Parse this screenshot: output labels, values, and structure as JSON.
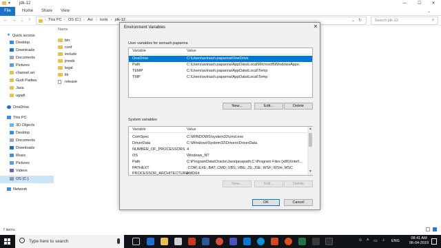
{
  "explorer": {
    "title": "jdk-12",
    "ribbon_tabs": [
      "File",
      "Home",
      "Share",
      "View"
    ],
    "breadcrumb": [
      "This PC",
      "OS (C:)",
      "Avi",
      "tools",
      "jdk-12"
    ],
    "search_placeholder": "Search jdk-12",
    "nav_items": [
      {
        "label": "Quick access"
      },
      {
        "label": "Desktop"
      },
      {
        "label": "Downloads"
      },
      {
        "label": "Documents"
      },
      {
        "label": "Pictures"
      },
      {
        "label": "channel art"
      },
      {
        "label": "Gudi Padwa"
      },
      {
        "label": "Java"
      },
      {
        "label": "ugadi"
      },
      {
        "label": "OneDrive"
      },
      {
        "label": "This PC"
      },
      {
        "label": "3D Objects"
      },
      {
        "label": "Desktop"
      },
      {
        "label": "Documents"
      },
      {
        "label": "Downloads"
      },
      {
        "label": "Music"
      },
      {
        "label": "Pictures"
      },
      {
        "label": "Videos"
      },
      {
        "label": "OS (C:)"
      },
      {
        "label": "Network"
      }
    ],
    "column_name": "Name",
    "files": [
      "bin",
      "conf",
      "include",
      "jmods",
      "legal",
      "lib",
      "release"
    ],
    "status": "7 items"
  },
  "dialog": {
    "title": "Environment Variables",
    "user_group_label": "User variables for avinash.papanna",
    "col_variable": "Variable",
    "col_value": "Value",
    "user_vars": [
      {
        "name": "OneDrive",
        "value": "C:\\Users\\avinash.papanna\\OneDrive"
      },
      {
        "name": "Path",
        "value": "C:\\Users\\avinash.papanna\\AppData\\Local\\Microsoft\\WindowsApps;"
      },
      {
        "name": "TEMP",
        "value": "C:\\Users\\avinash.papanna\\AppData\\Local\\Temp"
      },
      {
        "name": "TMP",
        "value": "C:\\Users\\avinash.papanna\\AppData\\Local\\Temp"
      }
    ],
    "system_group_label": "System variables",
    "system_vars": [
      {
        "name": "ComSpec",
        "value": "C:\\WINDOWS\\system32\\cmd.exe"
      },
      {
        "name": "DriverData",
        "value": "C:\\Windows\\System32\\Drivers\\DriverData"
      },
      {
        "name": "NUMBER_OF_PROCESSORS",
        "value": "4"
      },
      {
        "name": "OS",
        "value": "Windows_NT"
      },
      {
        "name": "Path",
        "value": "C:\\ProgramData\\Oracle\\Java\\javapath;C:\\Program Files (x86)\\Intel\\..."
      },
      {
        "name": "PATHEXT",
        "value": ".COM;.EXE;.BAT;.CMD;.VBS;.VBE;.JS;.JSE;.WSF;.WSH;.MSC"
      },
      {
        "name": "PROCESSOR_ARCHITECTURE",
        "value": "AMD64"
      }
    ],
    "btn_new": "New...",
    "btn_edit": "Edit...",
    "btn_delete": "Delete",
    "btn_ok": "OK",
    "btn_cancel": "Cancel"
  },
  "taskbar": {
    "search_text": "Type here to search",
    "lang": "ENG",
    "time": "08:41 AM",
    "date": "06-04-2019"
  },
  "colors": {
    "selection": "#0078d7",
    "file_tab": "#1a73c9",
    "taskbar": "#101418"
  }
}
